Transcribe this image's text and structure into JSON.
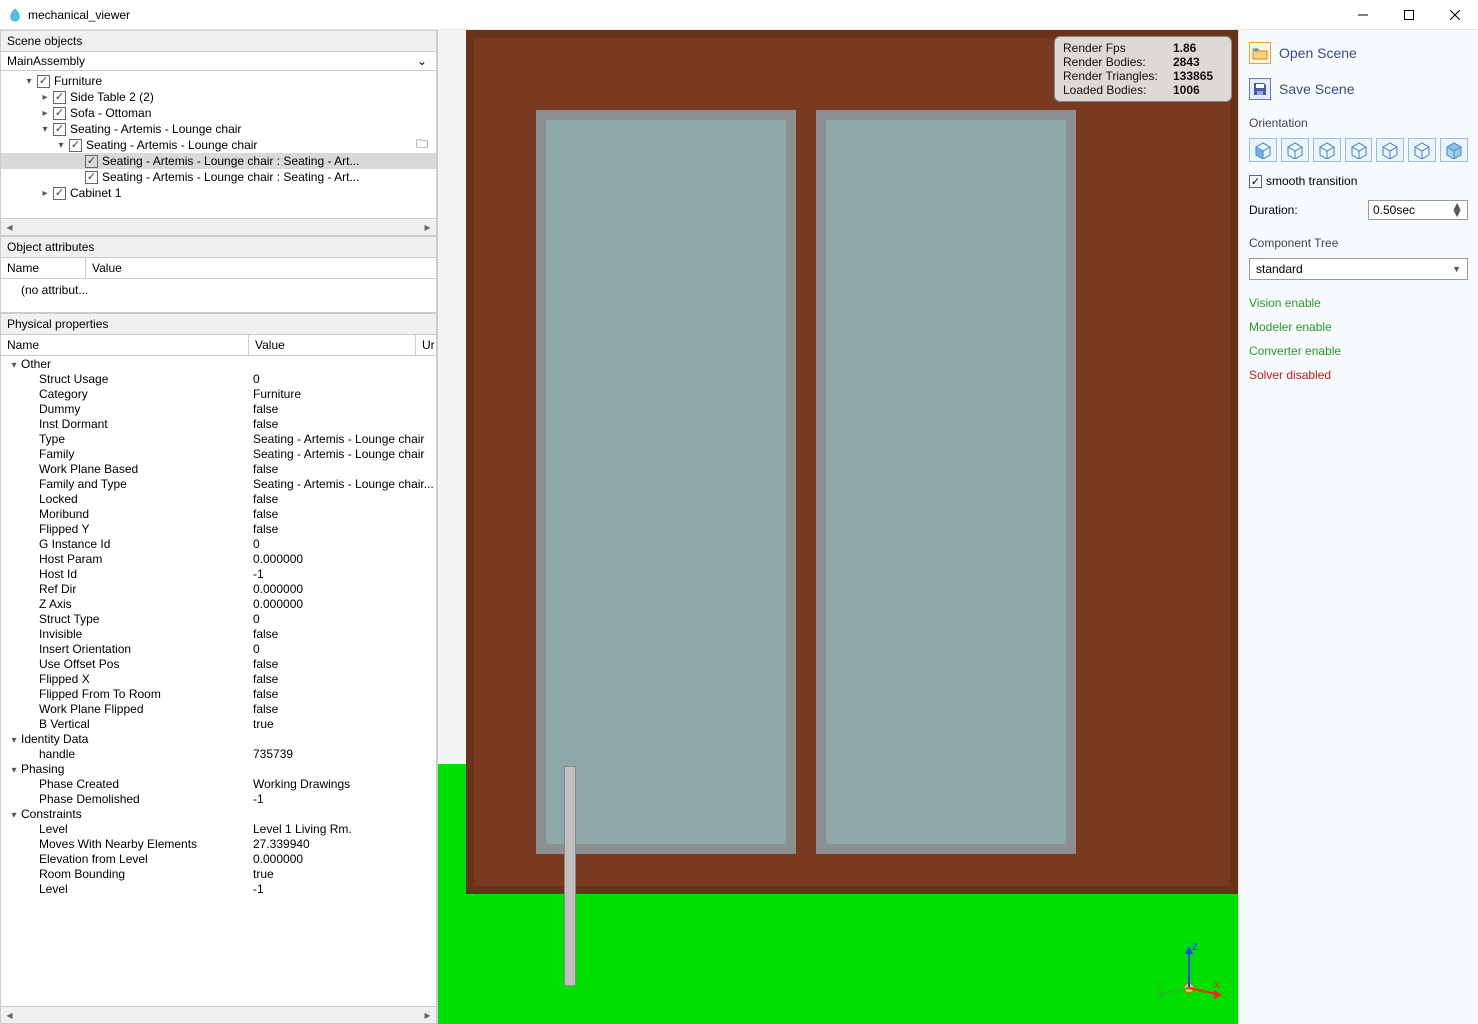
{
  "window": {
    "title": "mechanical_viewer"
  },
  "scene_objects": {
    "header": "Scene objects",
    "root": "MainAssembly",
    "items": [
      {
        "indent": 1,
        "arrow": "▾",
        "label": "Furniture"
      },
      {
        "indent": 2,
        "arrow": "▸",
        "label": "Side Table 2 (2)"
      },
      {
        "indent": 2,
        "arrow": "▸",
        "label": "Sofa - Ottoman"
      },
      {
        "indent": 2,
        "arrow": "▾",
        "label": "Seating - Artemis - Lounge chair"
      },
      {
        "indent": 3,
        "arrow": "▾",
        "label": "Seating - Artemis - Lounge chair",
        "iconRight": true
      },
      {
        "indent": 4,
        "arrow": "",
        "label": "Seating - Artemis - Lounge chair : Seating - Art...",
        "selected": true
      },
      {
        "indent": 4,
        "arrow": "",
        "label": "Seating - Artemis - Lounge chair : Seating - Art..."
      },
      {
        "indent": 2,
        "arrow": "▸",
        "label": "Cabinet 1"
      }
    ]
  },
  "object_attributes": {
    "header": "Object attributes",
    "col_name": "Name",
    "col_value": "Value",
    "empty": "(no attribut..."
  },
  "physical": {
    "header": "Physical properties",
    "col_name": "Name",
    "col_value": "Value",
    "col_unit": "Ur",
    "groups": [
      {
        "name": "Other",
        "rows": [
          {
            "n": "Struct Usage",
            "v": "0"
          },
          {
            "n": "Category",
            "v": "Furniture"
          },
          {
            "n": "Dummy",
            "v": "false"
          },
          {
            "n": "Inst Dormant",
            "v": "false"
          },
          {
            "n": "Type",
            "v": "Seating - Artemis - Lounge chair"
          },
          {
            "n": "Family",
            "v": "Seating - Artemis - Lounge chair"
          },
          {
            "n": "Work Plane Based",
            "v": "false"
          },
          {
            "n": "Family and Type",
            "v": "Seating - Artemis - Lounge chair..."
          },
          {
            "n": "Locked",
            "v": "false"
          },
          {
            "n": "Moribund",
            "v": "false"
          },
          {
            "n": "Flipped Y",
            "v": "false"
          },
          {
            "n": "G Instance Id",
            "v": "0"
          },
          {
            "n": "Host Param",
            "v": "0.000000"
          },
          {
            "n": "Host Id",
            "v": "-1"
          },
          {
            "n": "Ref Dir",
            "v": "0.000000"
          },
          {
            "n": "Z Axis",
            "v": "0.000000"
          },
          {
            "n": "Struct Type",
            "v": "0"
          },
          {
            "n": "Invisible",
            "v": "false"
          },
          {
            "n": "Insert Orientation",
            "v": "0"
          },
          {
            "n": "Use Offset Pos",
            "v": "false"
          },
          {
            "n": "Flipped X",
            "v": "false"
          },
          {
            "n": "Flipped From To Room",
            "v": "false"
          },
          {
            "n": "Work Plane Flipped",
            "v": "false"
          },
          {
            "n": "B Vertical",
            "v": "true"
          }
        ]
      },
      {
        "name": "Identity Data",
        "rows": [
          {
            "n": "handle",
            "v": "735739"
          }
        ]
      },
      {
        "name": "Phasing",
        "rows": [
          {
            "n": "Phase Created",
            "v": "Working Drawings"
          },
          {
            "n": "Phase Demolished",
            "v": "-1"
          }
        ]
      },
      {
        "name": "Constraints",
        "rows": [
          {
            "n": "Level",
            "v": "Level 1 Living Rm."
          },
          {
            "n": "Moves With Nearby Elements",
            "v": "27.339940"
          },
          {
            "n": "Elevation from Level",
            "v": "0.000000"
          },
          {
            "n": "Room Bounding",
            "v": "true"
          },
          {
            "n": "Level",
            "v": "-1"
          }
        ]
      }
    ]
  },
  "render_stats": {
    "rows": [
      {
        "l": "Render Fps",
        "v": "1.86"
      },
      {
        "l": "Render Bodies:",
        "v": "2843"
      },
      {
        "l": "Render Triangles:",
        "v": "133865"
      },
      {
        "l": "Loaded Bodies:",
        "v": "1006"
      }
    ]
  },
  "right": {
    "open": "Open Scene",
    "save": "Save Scene",
    "orientation_label": "Orientation",
    "smooth": "smooth transition",
    "duration_label": "Duration:",
    "duration_value": "0.50sec",
    "component_tree_label": "Component Tree",
    "component_tree_value": "standard",
    "statuses": [
      {
        "text": "Vision enable",
        "cls": "green"
      },
      {
        "text": "Modeler enable",
        "cls": "green"
      },
      {
        "text": "Converter enable",
        "cls": "green"
      },
      {
        "text": "Solver disabled",
        "cls": "red"
      }
    ]
  },
  "axis_labels": {
    "x": "x",
    "y": "y",
    "z": "z"
  }
}
